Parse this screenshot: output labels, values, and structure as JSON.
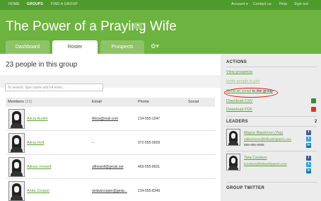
{
  "topnav": {
    "home": "HOME",
    "groups": "GROUPS",
    "find": "FIND A GROUP",
    "account": "Account",
    "contact": "Contact us",
    "help": "Help",
    "signout": "Sign out"
  },
  "header": {
    "title": "The Power of a Praying Wife",
    "title_button": "▾"
  },
  "tabs": {
    "dashboard": "Dashboard",
    "roster": "Roster",
    "prospects": "Prospects",
    "gear": "✿▾"
  },
  "main": {
    "count_title": "23 people in this group",
    "search_placeholder": "To search, type name and hit enter...",
    "columns": {
      "members": "Members",
      "members_count": "(23)",
      "email": "Email",
      "phone": "Phone",
      "social": "Social"
    },
    "rows": [
      {
        "name": "Alicia Austin",
        "email": "Alicia@mail.com",
        "phone": "214-555-1047"
      },
      {
        "name": "Alicia Holt",
        "email": "–",
        "phone": "972-555-9009"
      },
      {
        "name": "Allison Howell",
        "email": "allhowell@gmail.net",
        "phone": "469-555-8931"
      },
      {
        "name": "Anita Cooper",
        "email": "anitawcooper@gmai...",
        "phone": "214-555-8349"
      }
    ]
  },
  "sidebar": {
    "actions_heading": "ACTIONS",
    "view_prospects": "View prospects",
    "invite_people": "Invite people to join",
    "send_email_link": "Send an email",
    "send_email_rest": " to the group",
    "download_csv": "Download CSV",
    "download_pdf": "Download PDF",
    "leaders_heading": "LEADERS",
    "leaders_count": "2",
    "leaders": [
      {
        "name": "Mayce Blackmon",
        "role": " (You)",
        "email": "mblackmon@fellowshiptech.com",
        "phone": "555-555-5555"
      },
      {
        "name": "Tara Coulson",
        "role": "",
        "email": "tcoulson@fellowshiptech.com",
        "phone": ""
      }
    ],
    "twitter_heading": "GROUP TWITTER",
    "colors": {
      "accent": "#6cb33f",
      "link": "#5aa032",
      "annotation": "#dd1111"
    },
    "icons": {
      "csv": "spreadsheet-icon",
      "pdf": "pdf-icon"
    }
  }
}
